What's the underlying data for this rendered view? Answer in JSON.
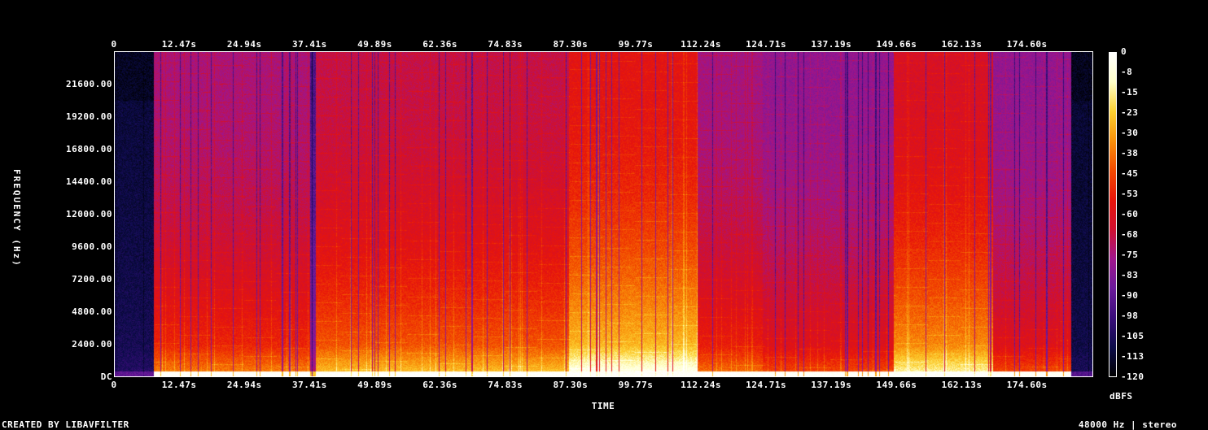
{
  "chart_data": {
    "type": "heatmap",
    "title": "",
    "xlabel": "TIME",
    "ylabel": "FREQUENCY (Hz)",
    "x_ticks": [
      "0",
      "12.47s",
      "24.94s",
      "37.41s",
      "49.89s",
      "62.36s",
      "74.83s",
      "87.30s",
      "99.77s",
      "112.24s",
      "124.71s",
      "137.19s",
      "149.66s",
      "162.13s",
      "174.60s"
    ],
    "x_tick_values": [
      0,
      12.47,
      24.94,
      37.41,
      49.89,
      62.36,
      74.83,
      87.3,
      99.77,
      112.24,
      124.71,
      137.19,
      149.66,
      162.13,
      174.6
    ],
    "xlim": [
      0,
      187.1
    ],
    "y_ticks": [
      "DC",
      "2400.00",
      "4800.00",
      "7200.00",
      "9600.00",
      "12000.00",
      "14400.00",
      "16800.00",
      "19200.00",
      "21600.00"
    ],
    "y_tick_values": [
      0,
      2400,
      4800,
      7200,
      9600,
      12000,
      14400,
      16800,
      19200,
      21600
    ],
    "ylim": [
      0,
      24000
    ],
    "colorbar": {
      "label": "dBFS",
      "ticks": [
        "0",
        "-8",
        "-15",
        "-23",
        "-30",
        "-38",
        "-45",
        "-53",
        "-60",
        "-68",
        "-75",
        "-83",
        "-90",
        "-98",
        "-105",
        "-113",
        "-120"
      ],
      "range": [
        -120,
        0
      ],
      "colors": [
        "#000000",
        "#0c0c4a",
        "#3a0d7a",
        "#6b1a9a",
        "#a0158c",
        "#cf1030",
        "#e8150a",
        "#f24a00",
        "#f9900a",
        "#fcd030",
        "#ffffc8",
        "#ffffff"
      ]
    },
    "activity_envelope": {
      "description_free": true,
      "segments": [
        {
          "t": [
            0,
            7.5
          ],
          "level": 0.12
        },
        {
          "t": [
            7.5,
            37.5
          ],
          "level": 0.62
        },
        {
          "t": [
            37.5,
            38.6
          ],
          "level": 0.35
        },
        {
          "t": [
            38.6,
            87.0
          ],
          "level": 0.7
        },
        {
          "t": [
            87.0,
            111.5
          ],
          "level": 0.85
        },
        {
          "t": [
            111.5,
            124.0
          ],
          "level": 0.6
        },
        {
          "t": [
            124.0,
            149.0
          ],
          "level": 0.55
        },
        {
          "t": [
            149.0,
            168.0
          ],
          "level": 0.78
        },
        {
          "t": [
            168.0,
            183.0
          ],
          "level": 0.55
        },
        {
          "t": [
            183.0,
            187.1
          ],
          "level": 0.1
        }
      ]
    }
  },
  "footer": {
    "left": "CREATED BY LIBAVFILTER",
    "right": "48000 Hz | stereo"
  }
}
